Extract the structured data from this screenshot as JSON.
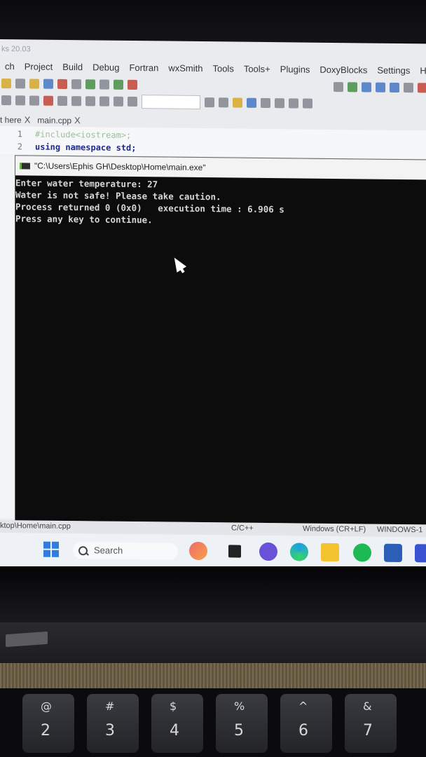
{
  "ide": {
    "title": "ks 20.03",
    "menu": [
      "ch",
      "Project",
      "Build",
      "Debug",
      "Fortran",
      "wxSmith",
      "Tools",
      "Tools+",
      "Plugins",
      "DoxyBlocks",
      "Settings",
      "He"
    ],
    "tabs": [
      {
        "label": "t here",
        "close": "X"
      },
      {
        "label": "main.cpp",
        "close": "X"
      }
    ],
    "code": [
      {
        "line": "1",
        "text": "#include<iostream>;"
      },
      {
        "line": "2",
        "text": "using namespace std;"
      }
    ]
  },
  "console": {
    "title": "\"C:\\Users\\Ephis GH\\Desktop\\Home\\main.exe\"",
    "lines": [
      "Enter water temperature: 27",
      "Water is not safe! Please take caution.",
      "",
      "Process returned 0 (0x0)   execution time : 6.906 s",
      "Press any key to continue."
    ]
  },
  "statusbar": {
    "path": "ktop\\Home\\main.cpp",
    "language": "C/C++",
    "line_endings": "Windows (CR+LF)",
    "encoding": "WINDOWS-1"
  },
  "taskbar": {
    "search_label": "Search",
    "apps": [
      "start-icon",
      "search-icon",
      "widgets-icon",
      "task-view-icon",
      "teams-chat-icon",
      "edge-icon",
      "file-explorer-icon",
      "spotify-icon",
      "word-icon",
      "app-icon"
    ]
  },
  "keyboard": [
    {
      "top": "@",
      "bottom": "2"
    },
    {
      "top": "#",
      "bottom": "3"
    },
    {
      "top": "$",
      "bottom": "4"
    },
    {
      "top": "%",
      "bottom": "5"
    },
    {
      "top": "^",
      "bottom": "6"
    },
    {
      "top": "&",
      "bottom": "7"
    }
  ],
  "colors": {
    "console_bg": "#0c0c0c",
    "console_text": "#d6d6d6",
    "taskbar_bg": "#eef1f6",
    "start_blue": "#2f7de1"
  }
}
